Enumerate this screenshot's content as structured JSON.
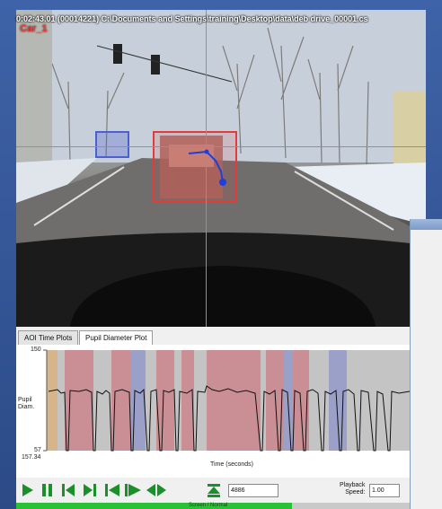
{
  "video": {
    "overlay_text": "0:02:43.01  (00014221)  C:\\Documents and Settings\\training\\Desktop\\data\\deb drive_00001.cs",
    "aoi_label": "Car_1"
  },
  "tabs": [
    {
      "label": "AOI Time Plots",
      "active": false
    },
    {
      "label": "Pupil Diameter Plot",
      "active": true
    }
  ],
  "plot": {
    "y_max_label": "150",
    "y_min_label": "57",
    "x_start_label": "157.34",
    "y_axis_label_line1": "Pupil",
    "y_axis_label_line2": "Diam.",
    "x_axis_label": "Time (seconds)"
  },
  "controls": {
    "frame_value": "4886",
    "speed_label_line1": "Playback",
    "speed_label_line2": "Speed:",
    "speed_value": "1.00",
    "progress_text": "Screen / Normal",
    "progress_fraction": 0.7
  },
  "colors": {
    "aoi_red": "#e33a3a",
    "aoi_blue": "#4b5fd1",
    "band_red": "#c98f95",
    "band_blue": "#9aa0c8",
    "band_orange": "#d6b58a",
    "band_gray": "#c4c4c4",
    "gaze_blue": "#1f3fd6",
    "crosshair_green": "#35d13a",
    "progress_green": "#29c236"
  },
  "icons": [
    "play-icon",
    "pause-icon",
    "step-back-icon",
    "step-forward-icon",
    "skip-to-start-icon",
    "fast-forward-icon",
    "rewind-icon",
    "go-to-frame-icon"
  ]
}
